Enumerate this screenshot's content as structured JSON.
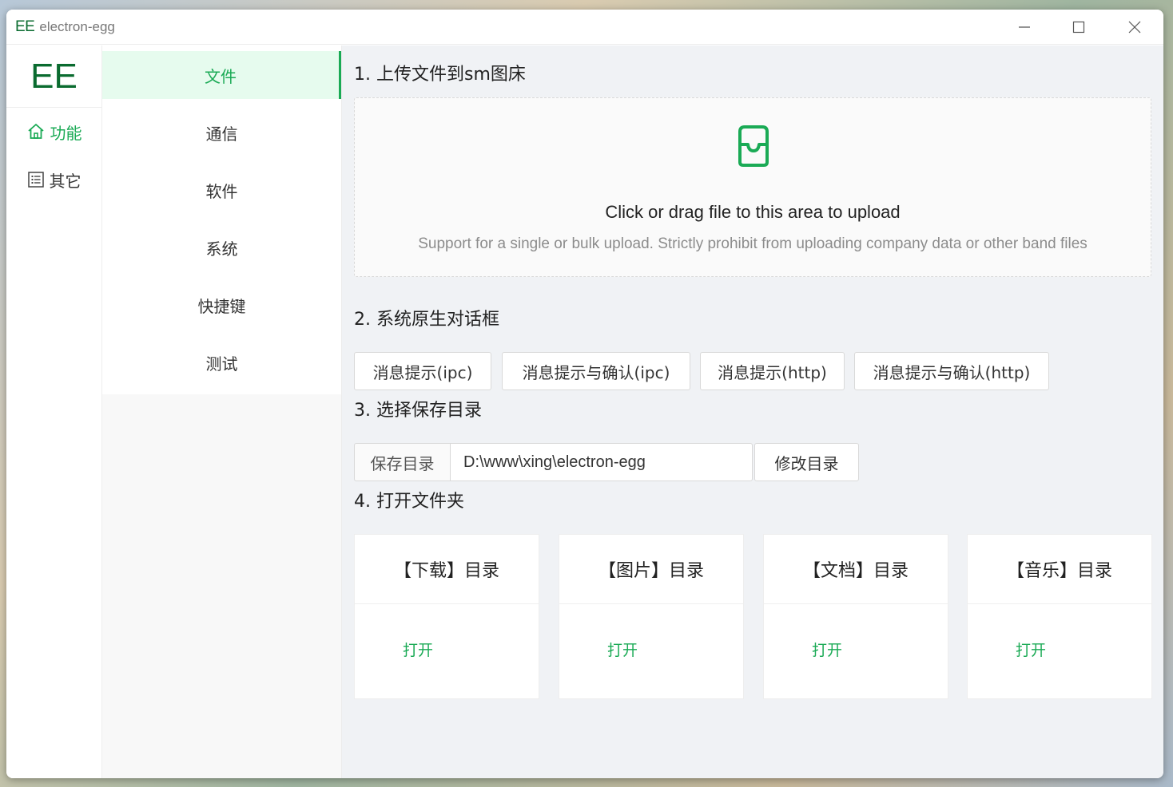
{
  "window": {
    "logo": "EE",
    "title": "electron-egg"
  },
  "rail": {
    "brand": "EE",
    "items": [
      {
        "label": "功能",
        "icon": "home-icon",
        "active": true
      },
      {
        "label": "其它",
        "icon": "list-icon",
        "active": false
      }
    ]
  },
  "submenu": {
    "items": [
      {
        "label": "文件",
        "active": true
      },
      {
        "label": "通信"
      },
      {
        "label": "软件"
      },
      {
        "label": "系统"
      },
      {
        "label": "快捷键"
      },
      {
        "label": "测试"
      }
    ]
  },
  "main": {
    "section1": {
      "title": "1. 上传文件到sm图床",
      "upload_text": "Click or drag file to this area to upload",
      "upload_hint": "Support for a single or bulk upload. Strictly prohibit from uploading company data or other band files",
      "icon": "inbox-icon"
    },
    "section2": {
      "title": "2. 系统原生对话框",
      "buttons": [
        "消息提示(ipc)",
        "消息提示与确认(ipc)",
        "消息提示(http)",
        "消息提示与确认(http)"
      ]
    },
    "section3": {
      "title": "3. 选择保存目录",
      "addon_label": "保存目录",
      "dir_value": "D:\\www\\xing\\electron-egg",
      "change_button": "修改目录"
    },
    "section4": {
      "title": "4. 打开文件夹",
      "cards": [
        {
          "title": "【下载】目录",
          "link": "打开"
        },
        {
          "title": "【图片】目录",
          "link": "打开"
        },
        {
          "title": "【文档】目录",
          "link": "打开"
        },
        {
          "title": "【音乐】目录",
          "link": "打开"
        }
      ]
    }
  },
  "colors": {
    "accent": "#1aaa55",
    "brand": "#0a6b2f",
    "active_bg": "#e6fbee"
  }
}
